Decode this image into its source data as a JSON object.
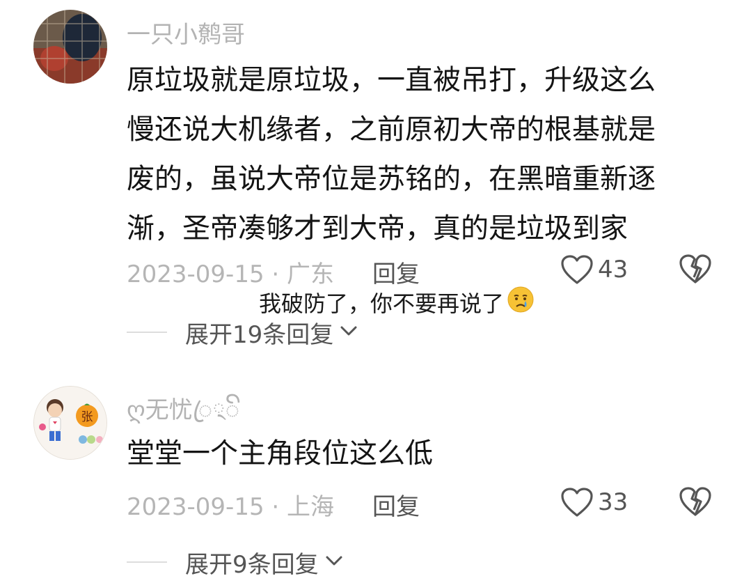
{
  "comments": [
    {
      "username": "一只小鹩哥",
      "lines": [
        "原垃圾就是原垃圾，一直被吊打，升级这么",
        "慢还说大机缘者，之前原初大帝的根基就是",
        "废的，虽说大帝位是苏铭的，在黑暗重新逐",
        "渐，圣帝凑够才到大帝，真的是垃圾到家"
      ],
      "meta": "2023-09-15 · 广东",
      "reply_label": "回复",
      "likes": "43",
      "expand_label": "展开19条回复"
    },
    {
      "username": "ღ无忧ꦿ྄ꦼ",
      "lines": [
        "堂堂一个主角段位这么低"
      ],
      "meta": "2023-09-15 · 上海",
      "reply_label": "回复",
      "likes": "33",
      "expand_label": "展开9条回复"
    }
  ],
  "overlay_caption": {
    "text": "我破防了，你不要再说了",
    "emoji": "😢"
  }
}
